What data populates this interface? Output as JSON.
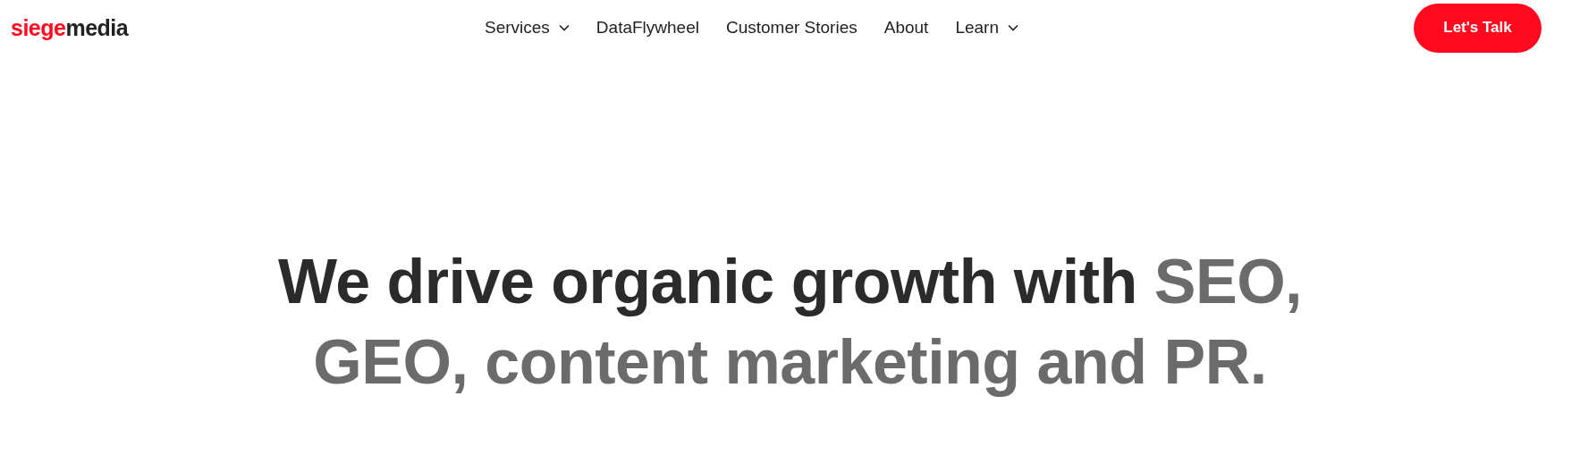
{
  "logo": {
    "parts": [
      {
        "text": "siege",
        "color": "#ff0a1e"
      },
      {
        "text": "media",
        "color": "#222222"
      }
    ]
  },
  "nav": [
    {
      "label": "Services",
      "has_menu": true
    },
    {
      "label": "DataFlywheel",
      "has_menu": false
    },
    {
      "label": "Customer Stories",
      "has_menu": false
    },
    {
      "label": "About",
      "has_menu": false
    },
    {
      "label": "Learn",
      "has_menu": true
    }
  ],
  "cta_button": {
    "label": "Let's Talk"
  },
  "headline": {
    "parts": [
      {
        "text": "We drive organic growth with ",
        "color": "#2b2b2b"
      },
      {
        "text": "SEO, GEO, content marketing and PR.",
        "color": "#6b6b6b"
      }
    ]
  }
}
